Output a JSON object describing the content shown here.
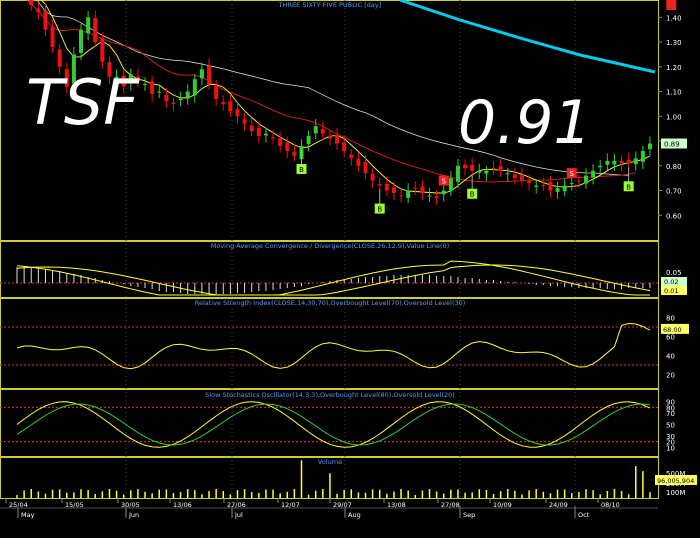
{
  "ticker_overlay": "TSF",
  "price_overlay": "0.91",
  "main": {
    "title": "THREE SIXTY FIVE PUBLIC [day]",
    "ticks": [
      "1.40",
      "1.30",
      "1.20",
      "1.10",
      "1.00",
      "0.90",
      "0.80",
      "0.70",
      "0.60"
    ],
    "last_price": "0.89",
    "signal_buy": "B",
    "signal_sell": "S"
  },
  "macd": {
    "title": "Moving Average Convergence / Divergence(CLOSE,26,12,9),Value Line(0)",
    "ticks": [
      "0.05",
      "0.00"
    ],
    "readouts": [
      "0.02",
      "0.01"
    ]
  },
  "rsi": {
    "title": "Relative Strength Index(CLOSE,14,30,70),Overbought Level(70),Oversold Level(30)",
    "ticks": [
      "80",
      "60",
      "40",
      "20"
    ],
    "readout": "68.00"
  },
  "stoch": {
    "title": "Slow Stochastics Oscillator(14,3,3),Overbought Level(80),Oversold Level(20)",
    "ticks": [
      "90",
      "80",
      "70",
      "50",
      "30",
      "20",
      "10"
    ]
  },
  "volume": {
    "title": "Volume",
    "ticks": [
      "500M",
      "200M",
      "100M"
    ],
    "readout": "96,005,904"
  },
  "xaxis": {
    "dates": [
      "25/04",
      "15/05",
      "30/05",
      "13/06",
      "27/06",
      "12/07",
      "29/07",
      "13/08",
      "27/08",
      "10/09",
      "24/09",
      "08/10"
    ],
    "months": [
      "May",
      "Jun",
      "Jul",
      "Aug",
      "Sep",
      "Oct"
    ]
  },
  "colors": {
    "up": "#33cc33",
    "down": "#ee1111",
    "ma_short": "#ffff33",
    "ma_mid": "#dd2222",
    "ma_long": "#dddddd",
    "ma_xlong": "#00ccee",
    "panel_border": "#cccc33",
    "title": "#5599ff",
    "buy": "#99ff33",
    "sell": "#ee2222"
  },
  "chart_data": {
    "type": "candlestick",
    "title": "THREE SIXTY FIVE PUBLIC [day]",
    "ylim": [
      0.5,
      1.47
    ],
    "close": [
      1.55,
      1.5,
      1.45,
      1.42,
      1.35,
      1.28,
      1.2,
      1.12,
      1.25,
      1.35,
      1.4,
      1.3,
      1.22,
      1.16,
      1.16,
      1.12,
      1.17,
      1.14,
      1.13,
      1.09,
      1.1,
      1.06,
      1.05,
      1.07,
      1.1,
      1.15,
      1.19,
      1.13,
      1.07,
      1.05,
      1.02,
      1.0,
      0.97,
      0.94,
      0.92,
      0.93,
      0.91,
      0.88,
      0.86,
      0.84,
      0.88,
      0.92,
      0.96,
      0.93,
      0.91,
      0.89,
      0.86,
      0.83,
      0.8,
      0.77,
      0.74,
      0.72,
      0.7,
      0.69,
      0.68,
      0.7,
      0.71,
      0.69,
      0.68,
      0.67,
      0.7,
      0.75,
      0.8,
      0.79,
      0.78,
      0.78,
      0.78,
      0.79,
      0.78,
      0.77,
      0.75,
      0.74,
      0.73,
      0.72,
      0.72,
      0.7,
      0.71,
      0.72,
      0.73,
      0.74,
      0.76,
      0.78,
      0.8,
      0.82,
      0.82,
      0.81,
      0.81,
      0.83,
      0.86,
      0.89
    ],
    "buy_signals": [
      40,
      51,
      64,
      86,
      111,
      127
    ],
    "sell_signals": [
      60,
      78,
      92,
      124
    ]
  }
}
